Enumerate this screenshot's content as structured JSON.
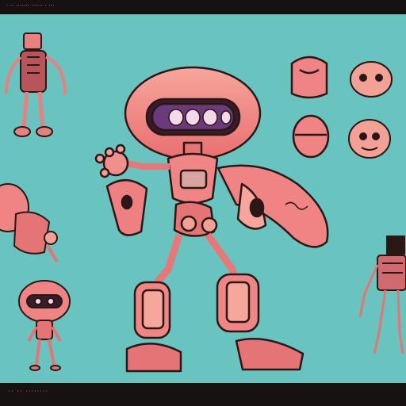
{
  "header": {
    "caption": "· ·· ······· ······ · ···"
  },
  "footer": {
    "caption": "·· ·· ········"
  },
  "palette": {
    "background": "#69c3be",
    "robot_pink": "#f07b7a",
    "robot_light": "#f5a39a",
    "outline": "#2a1716",
    "accent_purple": "#7b3d8a",
    "frame": "#1d1616"
  },
  "figures": [
    "main-robot-character",
    "standing-robot-side-view",
    "small-robot-front-view",
    "crouching-robot-side-view",
    "back-view-robot-skeleton",
    "head-study-top",
    "head-study-side",
    "head-study-bottom",
    "head-study-face"
  ]
}
